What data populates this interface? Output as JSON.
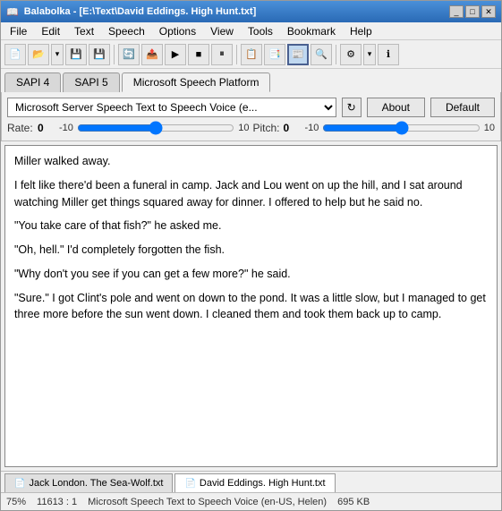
{
  "window": {
    "title": "Balabolka - [E:\\Text\\David Eddings. High Hunt.txt]",
    "icon": "📖"
  },
  "menu": {
    "items": [
      "File",
      "Edit",
      "Text",
      "Speech",
      "Options",
      "View",
      "Tools",
      "Bookmark",
      "Help"
    ]
  },
  "toolbar": {
    "buttons": [
      {
        "name": "new",
        "icon": "📄"
      },
      {
        "name": "open",
        "icon": "📂"
      },
      {
        "name": "open-dropdown",
        "icon": "▾"
      },
      {
        "name": "save",
        "icon": "💾"
      },
      {
        "name": "save2",
        "icon": "💾"
      },
      {
        "name": "sep1",
        "icon": ""
      },
      {
        "name": "convert",
        "icon": "🔄"
      },
      {
        "name": "export",
        "icon": "📤"
      },
      {
        "name": "play",
        "icon": "▶"
      },
      {
        "name": "stop",
        "icon": "■"
      },
      {
        "name": "pause",
        "icon": "⏸"
      },
      {
        "name": "sep2",
        "icon": ""
      },
      {
        "name": "clip",
        "icon": "📋"
      },
      {
        "name": "batch",
        "icon": "📑"
      },
      {
        "name": "active-btn",
        "icon": "📰",
        "active": true
      },
      {
        "name": "browse",
        "icon": "🔍"
      },
      {
        "name": "sep3",
        "icon": ""
      },
      {
        "name": "settings-dropdown",
        "icon": "▾"
      },
      {
        "name": "settings",
        "icon": "⚙"
      }
    ]
  },
  "tabs": {
    "items": [
      "SAPI 4",
      "SAPI 5",
      "Microsoft Speech Platform"
    ],
    "active": 2
  },
  "voice_panel": {
    "voice_select": "Microsoft Server Speech Text to Speech Voice (e...",
    "refresh_label": "↻",
    "about_label": "About",
    "default_label": "Default",
    "rate": {
      "label": "Rate:",
      "value": "0",
      "min": "-10",
      "max": "10"
    },
    "pitch": {
      "label": "Pitch:",
      "value": "0",
      "min": "-10",
      "max": "10"
    }
  },
  "text_content": {
    "paragraphs": [
      "Miller walked away.",
      "I felt like there'd been a funeral in camp. Jack and Lou went on up the hill, and I sat around watching Miller get things squared away for dinner. I offered to help but he said no.",
      "\"You take care of that fish?\" he asked me.",
      "\"Oh, hell.\" I'd completely forgotten the fish.",
      "\"Why don't you see if you can get a few more?\" he said.",
      "\"Sure.\" I got Clint's pole and went on down to the pond. It was a little slow, but I managed to get three more before the sun went down. I cleaned them and took them back up to camp."
    ]
  },
  "bottom_tabs": {
    "items": [
      {
        "label": "Jack London. The Sea-Wolf.txt",
        "icon": "📄"
      },
      {
        "label": "David Eddings. High Hunt.txt",
        "icon": "📄",
        "active": true
      }
    ]
  },
  "status_bar": {
    "zoom": "75%",
    "position": "11613 : 1",
    "voice": "Microsoft Speech Text to Speech Voice (en-US, Helen)",
    "size": "695 KB"
  }
}
